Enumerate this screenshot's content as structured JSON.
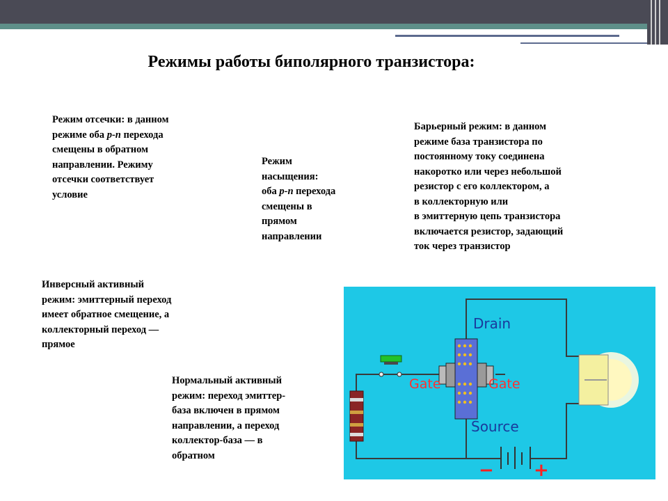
{
  "slide": {
    "title": "Режимы работы биполярного транзистора:",
    "cutoff": {
      "lines": [
        "Режим отсечки: в данном",
        "режиме оба ",
        "p-n",
        " перехода",
        "смещены в обратном",
        "направлении. Режиму",
        "отсечки соответствует",
        "условие"
      ]
    },
    "saturation": {
      "lines": [
        "Режим",
        "насыщения:",
        "оба ",
        "p-n",
        " перехода",
        "смещены в",
        "прямом",
        "направлении"
      ]
    },
    "barrier": {
      "lines": [
        "Барьерный режим: в данном",
        "режиме база транзистора по",
        "постоянному току соединена",
        "накоротко или через небольшой",
        "резистор с его коллектором, а",
        "в коллекторную или",
        "в эмиттерную цепь транзистора",
        "включается резистор, задающий",
        "ток через транзистор"
      ]
    },
    "inverse": {
      "lines": [
        "Инверсный активный",
        "режим: эмиттерный переход",
        "имеет обратное смещение, а",
        "коллекторный переход —",
        "прямое"
      ]
    },
    "normal": {
      "lines": [
        "Нормальный активный",
        "режим: переход эмиттер-",
        "база включен в прямом",
        "направлении, а переход",
        "коллектор-база — в",
        "обратном"
      ]
    },
    "circuit": {
      "drain_label": "Drain",
      "source_label": "Source",
      "gate_left_label": "Gate",
      "gate_right_label": "Gate",
      "minus_label": "−",
      "plus_label": "+"
    }
  },
  "colors": {
    "circuit_background": "#1ec8e6",
    "gate_text": "#ff3030",
    "terminal_text": "#1a3a9c"
  }
}
